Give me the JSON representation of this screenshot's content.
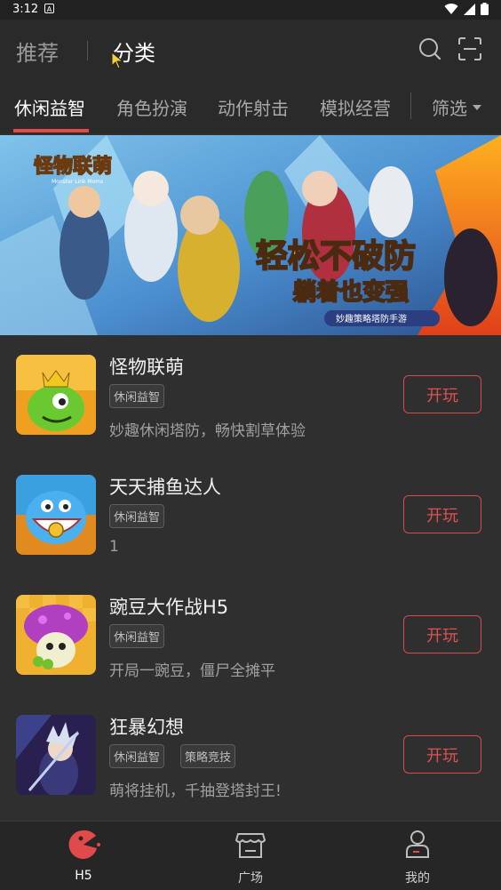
{
  "status_bar": {
    "time": "3:12",
    "notification": "A"
  },
  "top_tabs": {
    "recommend": "推荐",
    "category": "分类"
  },
  "category_tabs": [
    "休闲益智",
    "角色扮演",
    "动作射击",
    "模拟经营"
  ],
  "filter_label": "筛选",
  "banner": {
    "logo_text": "怪物联萌",
    "logo_sub": "Monster Link Moms",
    "slogan_line1": "轻松不破防",
    "slogan_line2": "躺着也变强",
    "tagline": "妙趣策略塔防手游"
  },
  "games": [
    {
      "name": "怪物联萌",
      "tags": [
        "休闲益智"
      ],
      "desc": "妙趣休闲塔防，畅快割草体验",
      "button": "开玩",
      "icon": "green-monster-icon"
    },
    {
      "name": "天天捕鱼达人",
      "tags": [
        "休闲益智"
      ],
      "desc": "1",
      "button": "开玩",
      "icon": "fish-icon"
    },
    {
      "name": "豌豆大作战H5",
      "tags": [
        "休闲益智"
      ],
      "desc": "开局一豌豆，僵尸全摊平",
      "button": "开玩",
      "icon": "mushroom-icon"
    },
    {
      "name": "狂暴幻想",
      "tags": [
        "休闲益智",
        "策略竞技"
      ],
      "desc": "萌将挂机，千抽登塔封王!",
      "button": "开玩",
      "icon": "warrior-icon"
    }
  ],
  "bottom_nav": [
    {
      "label": "H5",
      "icon": "h5-pacman-icon",
      "active": true
    },
    {
      "label": "广场",
      "icon": "store-icon",
      "active": false
    },
    {
      "label": "我的",
      "icon": "person-icon",
      "active": false
    }
  ],
  "colors": {
    "accent": "#e04a4a",
    "background": "#2f2f2f",
    "topbar": "#2a2a2a"
  }
}
